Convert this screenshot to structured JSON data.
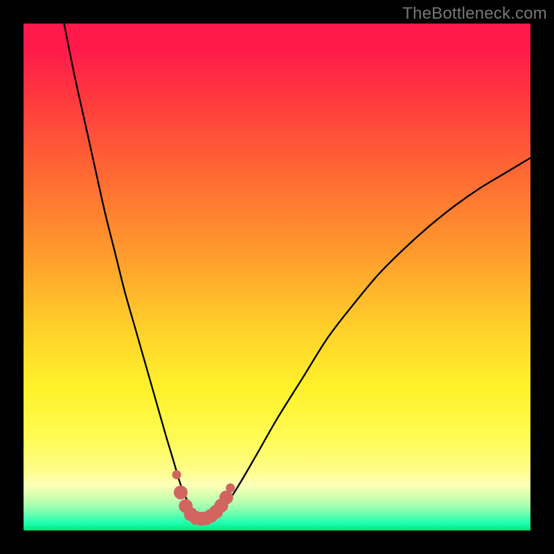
{
  "attribution": "TheBottleneck.com",
  "chart_data": {
    "type": "line",
    "title": "",
    "xlabel": "",
    "ylabel": "",
    "xlim": [
      0,
      100
    ],
    "ylim": [
      0,
      100
    ],
    "series": [
      {
        "name": "bottleneck-curve",
        "x": [
          8,
          10,
          12,
          14,
          16,
          18,
          20,
          22,
          24,
          26,
          28,
          29.5,
          31,
          32.5,
          34,
          36,
          38,
          40,
          42.5,
          46,
          50,
          55,
          60,
          65,
          70,
          75,
          80,
          85,
          90,
          95,
          100
        ],
        "y": [
          100,
          90,
          81,
          72,
          63,
          55,
          47,
          40,
          33,
          26,
          19,
          14,
          9,
          5.5,
          3.3,
          2.6,
          3.1,
          5.2,
          9,
          15,
          22,
          30,
          38,
          44.5,
          50.5,
          55.5,
          60,
          64,
          67.5,
          70.5,
          73.5
        ]
      },
      {
        "name": "highlight-dots",
        "x": [
          30.2,
          31.0,
          32.0,
          33.0,
          34.0,
          35.0,
          36.0,
          37.0,
          38.0,
          39.0,
          40.0,
          40.8
        ],
        "y": [
          11.0,
          7.5,
          4.8,
          3.2,
          2.5,
          2.3,
          2.4,
          2.9,
          3.7,
          4.9,
          6.5,
          8.4
        ]
      }
    ],
    "highlight_color": "#d1645f",
    "curve_color": "#000000"
  }
}
